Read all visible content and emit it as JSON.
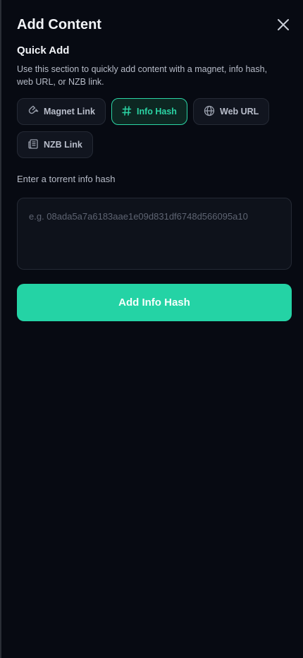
{
  "header": {
    "title": "Add Content",
    "close_icon": "close-icon"
  },
  "quick_add": {
    "title": "Quick Add",
    "description": "Use this section to quickly add content with a magnet, info hash, web URL, or NZB link.",
    "options": [
      {
        "label": "Magnet Link",
        "icon": "magnet-icon",
        "selected": false
      },
      {
        "label": "Info Hash",
        "icon": "hash-icon",
        "selected": true
      },
      {
        "label": "Web URL",
        "icon": "globe-icon",
        "selected": false
      },
      {
        "label": "NZB Link",
        "icon": "newspaper-icon",
        "selected": false
      }
    ]
  },
  "input": {
    "label": "Enter a torrent info hash",
    "placeholder": "e.g. 08ada5a7a6183aae1e09d831df6748d566095a10",
    "value": ""
  },
  "submit": {
    "label": "Add Info Hash"
  },
  "colors": {
    "background": "#070a12",
    "accent": "#24d3a5",
    "chip_border": "#252a35"
  }
}
